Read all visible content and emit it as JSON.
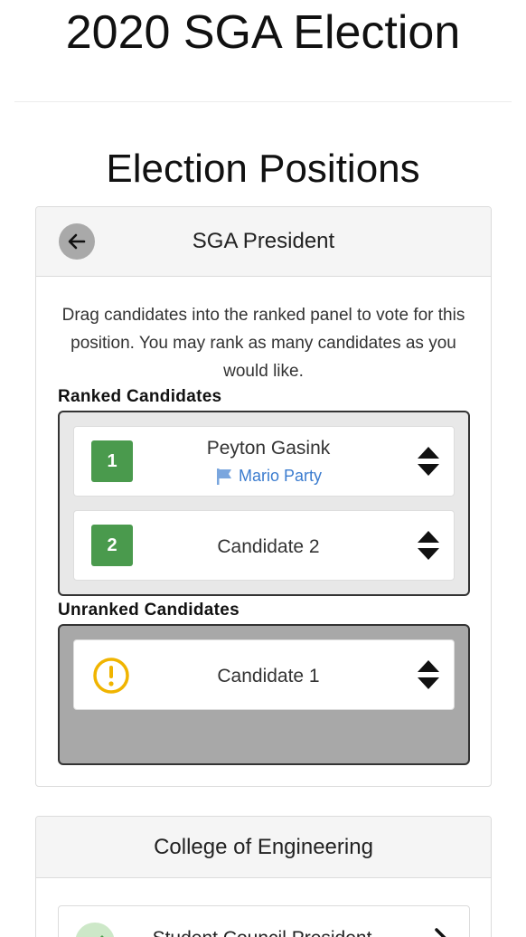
{
  "page_title": "2020 SGA Election",
  "section_title": "Election Positions",
  "position_card": {
    "header_title": "SGA President",
    "back_icon": "arrow-left-icon",
    "instructions": "Drag candidates into the ranked panel to vote for this position. You may rank as many candidates as you would like.",
    "ranked_label": "Ranked Candidates",
    "unranked_label": "Unranked Candidates",
    "ranked": [
      {
        "rank": "1",
        "name": "Peyton Gasink",
        "party": "Mario Party"
      },
      {
        "rank": "2",
        "name": "Candidate 2"
      }
    ],
    "unranked": [
      {
        "name": "Candidate 1",
        "status_icon": "exclamation-circle-icon"
      }
    ],
    "colors": {
      "rank_badge": "#4a9a4d",
      "warning": "#f0b400",
      "party_link": "#3b7ccf",
      "unranked_panel": "#a8a8a8",
      "ranked_panel": "#e8e8e8"
    }
  },
  "college_card": {
    "header_title": "College of Engineering",
    "rows": [
      {
        "label": "Student Council President",
        "status_icon": "check-icon",
        "action_icon": "arrow-right-icon"
      }
    ]
  }
}
